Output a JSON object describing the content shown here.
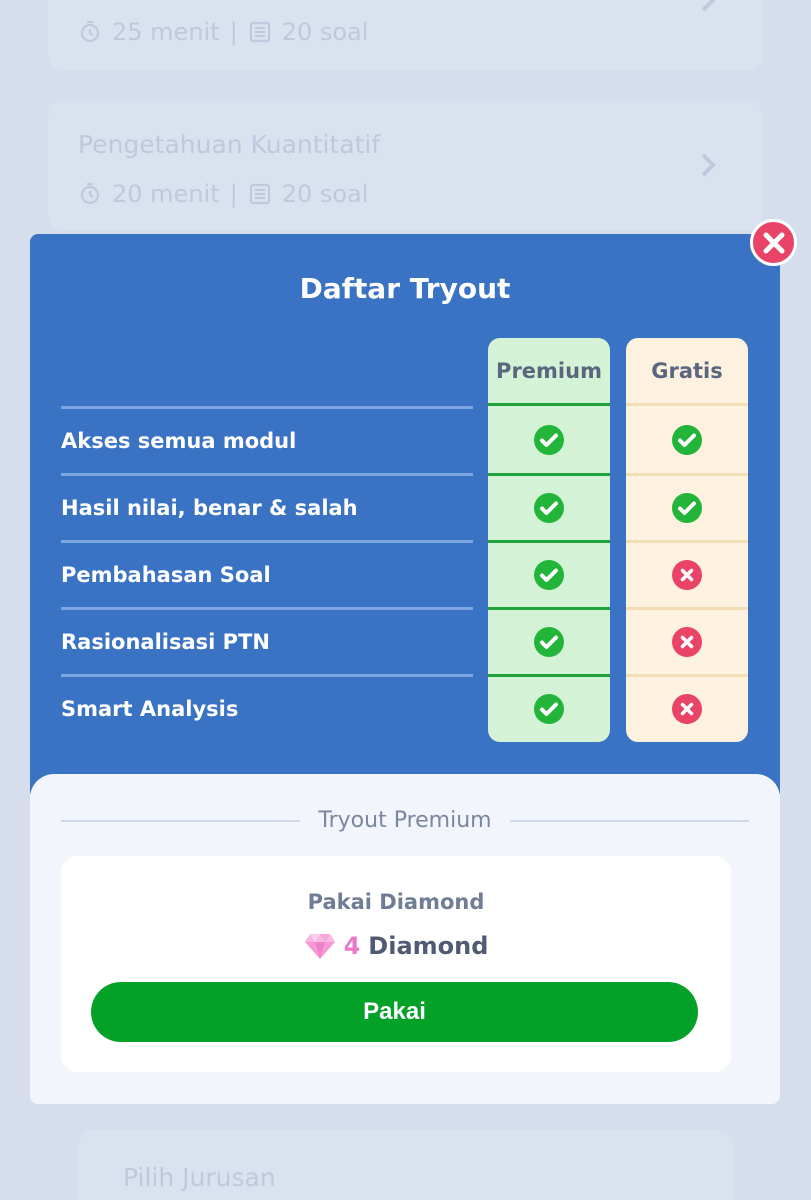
{
  "background": {
    "cards": [
      {
        "title": "",
        "duration": "25 menit",
        "separator": "|",
        "questions": "20 soal"
      },
      {
        "title": "Pengetahuan Kuantitatif",
        "duration": "20 menit",
        "separator": "|",
        "questions": "20 soal"
      }
    ],
    "bottom_card_title": "Pilih Jurusan"
  },
  "modal": {
    "title": "Daftar Tryout",
    "columns": {
      "premium": "Premium",
      "gratis": "Gratis"
    },
    "features": [
      {
        "label": "Akses semua modul",
        "premium": true,
        "gratis": true
      },
      {
        "label": "Hasil nilai, benar & salah",
        "premium": true,
        "gratis": true
      },
      {
        "label": "Pembahasan Soal",
        "premium": true,
        "gratis": false
      },
      {
        "label": "Rasionalisasi PTN",
        "premium": true,
        "gratis": false
      },
      {
        "label": "Smart Analysis",
        "premium": true,
        "gratis": false
      }
    ],
    "section_label": "Tryout Premium",
    "payment": {
      "method_label": "Pakai Diamond",
      "amount": "4",
      "unit": "Diamond",
      "button_label": "Pakai"
    }
  },
  "colors": {
    "header_blue": "#3a72c4",
    "check_green": "#22b53a",
    "cross_red": "#e94468",
    "button_green": "#03a128",
    "diamond_pink": "#e779c6"
  },
  "icons": {
    "close": "close-icon",
    "check": "check-circle-icon",
    "cross": "x-circle-icon",
    "diamond": "diamond-icon",
    "timer": "stopwatch-icon",
    "list": "list-icon",
    "chevron": "chevron-right-icon"
  }
}
